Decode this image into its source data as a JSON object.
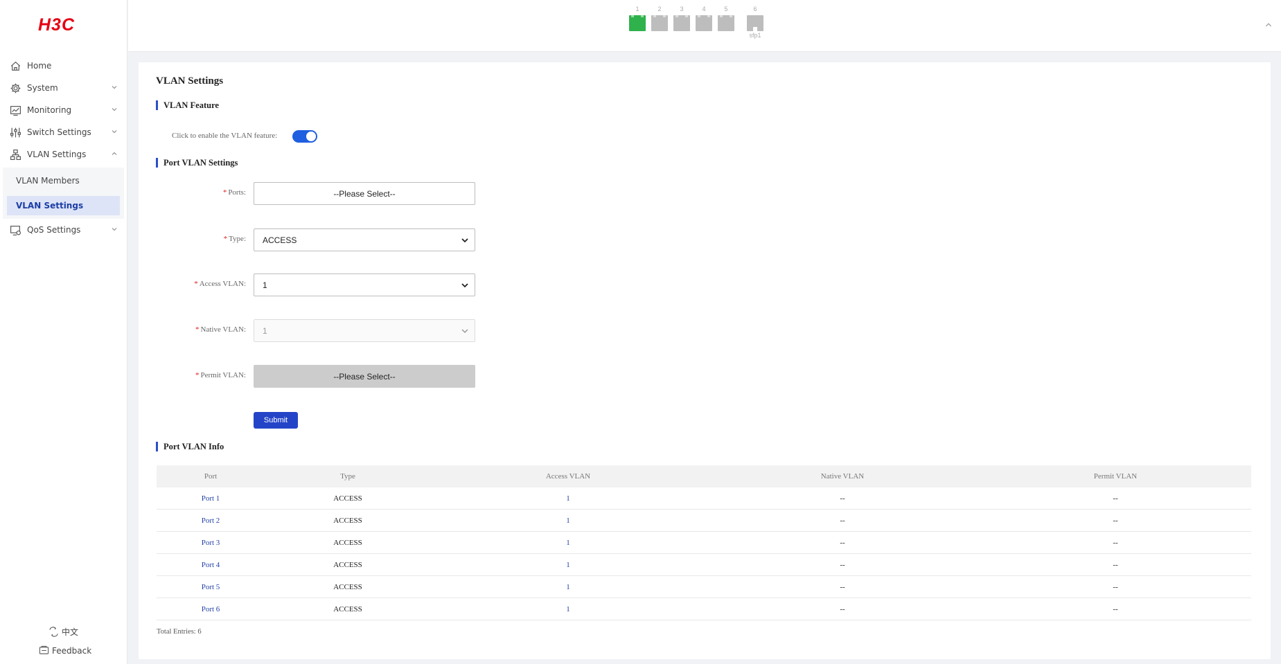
{
  "brand": {
    "logo_text": "H3C",
    "logo_color": "#e60012"
  },
  "sidebar": {
    "items": [
      {
        "label": "Home",
        "icon": "home-icon",
        "has_children": false
      },
      {
        "label": "System",
        "icon": "gear-icon",
        "has_children": true
      },
      {
        "label": "Monitoring",
        "icon": "monitor-chart-icon",
        "has_children": true
      },
      {
        "label": "Switch Settings",
        "icon": "sliders-icon",
        "has_children": true
      },
      {
        "label": "VLAN Settings",
        "icon": "network-icon",
        "has_children": true,
        "expanded": true
      },
      {
        "label": "QoS Settings",
        "icon": "qos-icon",
        "has_children": true
      }
    ],
    "vlan_submenu": [
      {
        "label": "VLAN Members",
        "active": false
      },
      {
        "label": "VLAN Settings",
        "active": true
      }
    ],
    "language_label": "中文",
    "feedback_label": "Feedback"
  },
  "topbar": {
    "ports": [
      {
        "num": "1",
        "status": "up",
        "sublabel": ""
      },
      {
        "num": "2",
        "status": "down",
        "sublabel": ""
      },
      {
        "num": "3",
        "status": "down",
        "sublabel": ""
      },
      {
        "num": "4",
        "status": "down",
        "sublabel": ""
      },
      {
        "num": "5",
        "status": "down",
        "sublabel": ""
      },
      {
        "num": "6",
        "status": "down",
        "sublabel": "sfp1"
      }
    ],
    "port_up_color": "#2fb24c",
    "port_down_color": "#bdbdbd"
  },
  "page": {
    "title": "VLAN Settings",
    "feature_section": "VLAN Feature",
    "feature_label": "Click to enable the VLAN feature:",
    "feature_enabled": true,
    "port_section": "Port VLAN Settings",
    "form": {
      "ports_label": "Ports:",
      "ports_value": "--Please Select--",
      "type_label": "Type:",
      "type_value": "ACCESS",
      "access_label": "Access VLAN:",
      "access_value": "1",
      "native_label": "Native VLAN:",
      "native_value": "1",
      "permit_label": "Permit VLAN:",
      "permit_value": "--Please Select--",
      "required_mark": "*"
    },
    "submit_label": "Submit",
    "info_section": "Port VLAN Info",
    "accent_color": "#2444c8"
  },
  "table": {
    "headers": [
      "Port",
      "Type",
      "Access VLAN",
      "Native VLAN",
      "Permit VLAN"
    ],
    "rows": [
      [
        "Port 1",
        "ACCESS",
        "1",
        "--",
        "--"
      ],
      [
        "Port 2",
        "ACCESS",
        "1",
        "--",
        "--"
      ],
      [
        "Port 3",
        "ACCESS",
        "1",
        "--",
        "--"
      ],
      [
        "Port 4",
        "ACCESS",
        "1",
        "--",
        "--"
      ],
      [
        "Port 5",
        "ACCESS",
        "1",
        "--",
        "--"
      ],
      [
        "Port 6",
        "ACCESS",
        "1",
        "--",
        "--"
      ]
    ],
    "total_label": "Total Entries: 6"
  }
}
